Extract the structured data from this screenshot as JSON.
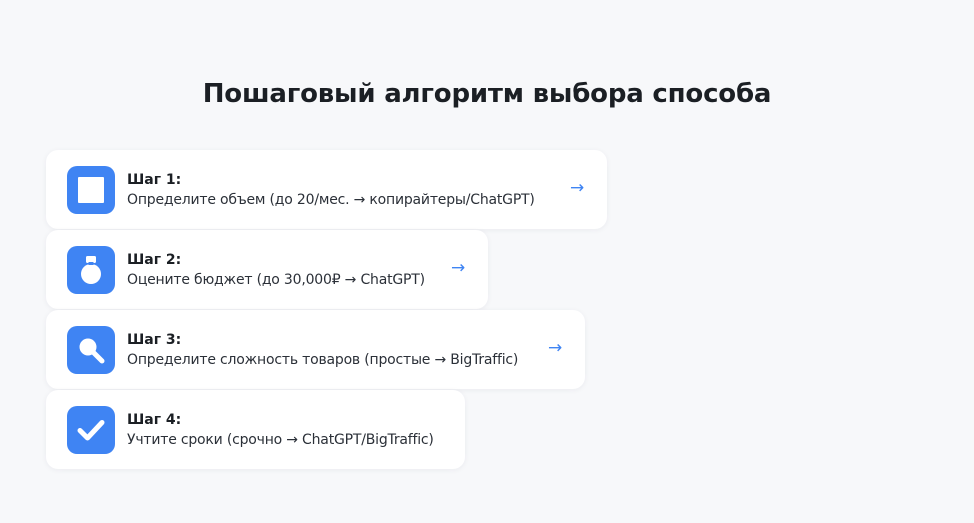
{
  "header": {
    "title": "Пошаговый алгоритм выбора способа"
  },
  "colors": {
    "accent": "#3f84f3",
    "background": "#f7f8fa",
    "card": "#ffffff"
  },
  "steps": [
    {
      "label": "Шаг 1:",
      "description": "Определите объем (до 20/мес. → копирайтеры/ChatGPT)",
      "icon": "square-icon",
      "arrow": "→"
    },
    {
      "label": "Шаг 2:",
      "description": "Оцените бюджет (до 30,000₽ → ChatGPT)",
      "icon": "money-bag-icon",
      "arrow": "→"
    },
    {
      "label": "Шаг 3:",
      "description": "Определите сложность товаров (простые → BigTraffic)",
      "icon": "magnifier-icon",
      "arrow": "→"
    },
    {
      "label": "Шаг 4:",
      "description": "Учтите сроки (срочно → ChatGPT/BigTraffic)",
      "icon": "checkmark-icon",
      "arrow": ""
    }
  ]
}
